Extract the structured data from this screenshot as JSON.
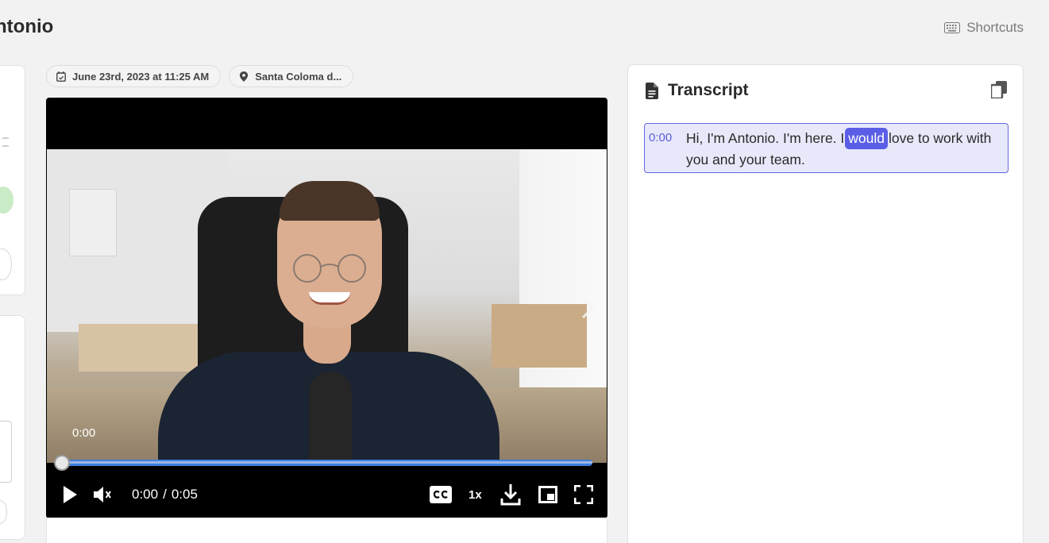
{
  "page": {
    "title": "ntonio"
  },
  "header": {
    "shortcuts_label": "Shortcuts"
  },
  "meta": {
    "date_label": "June 23rd, 2023 at 11:25 AM",
    "location_label": "Santa Coloma d..."
  },
  "player": {
    "hover_time": "0:00",
    "current_time": "0:00",
    "separator": "/",
    "duration": "0:05",
    "speed": "1x",
    "progress_fraction": 0.0,
    "accent": "#3d7fe0"
  },
  "transcript": {
    "title": "Transcript",
    "accent": "#5a5ee6",
    "entry": {
      "time": "0:00",
      "before": "Hi, I'm Antonio. I'm here. I",
      "highlight": "would",
      "after": "love to work with you and your team."
    }
  },
  "icons": {
    "shortcuts": "keyboard-icon",
    "date": "calendar-icon",
    "location": "map-pin-icon",
    "transcript": "document-icon",
    "copy": "copy-icon",
    "play": "play-icon",
    "volume": "volume-muted-icon",
    "cc": "closed-captions-icon",
    "download": "download-icon",
    "pip": "picture-in-picture-icon",
    "fullscreen": "fullscreen-icon",
    "next": "chevron-right-icon"
  }
}
